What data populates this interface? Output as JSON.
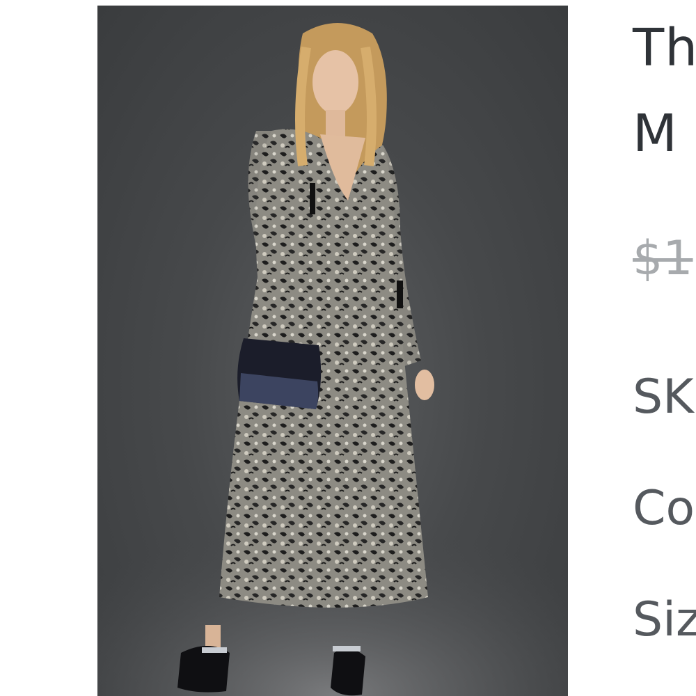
{
  "product": {
    "title_line1": "Th",
    "title_line2": "M",
    "original_price": "$1",
    "sku_label": "SK",
    "color_label": "Co",
    "size_label": "Siz"
  },
  "image": {
    "subject": "product-photo",
    "colors": {
      "backdrop": "#4a4c4e",
      "dress": "#7c7a72",
      "hair": "#c9a061",
      "shoes": "#0e0e10"
    }
  }
}
